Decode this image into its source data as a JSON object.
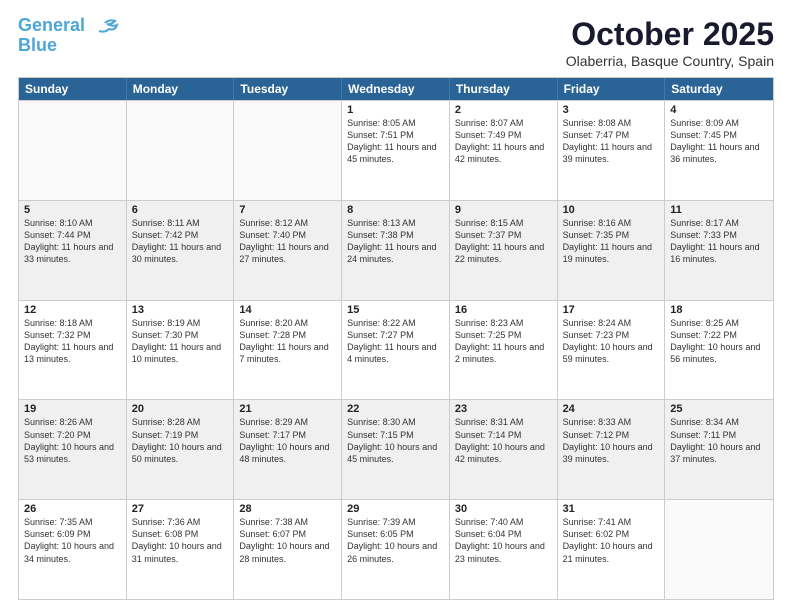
{
  "logo": {
    "line1": "General",
    "line2": "Blue"
  },
  "header": {
    "month": "October 2025",
    "location": "Olaberria, Basque Country, Spain"
  },
  "dayHeaders": [
    "Sunday",
    "Monday",
    "Tuesday",
    "Wednesday",
    "Thursday",
    "Friday",
    "Saturday"
  ],
  "weeks": [
    [
      {
        "num": "",
        "info": "",
        "empty": true
      },
      {
        "num": "",
        "info": "",
        "empty": true
      },
      {
        "num": "",
        "info": "",
        "empty": true
      },
      {
        "num": "1",
        "info": "Sunrise: 8:05 AM\nSunset: 7:51 PM\nDaylight: 11 hours\nand 45 minutes."
      },
      {
        "num": "2",
        "info": "Sunrise: 8:07 AM\nSunset: 7:49 PM\nDaylight: 11 hours\nand 42 minutes."
      },
      {
        "num": "3",
        "info": "Sunrise: 8:08 AM\nSunset: 7:47 PM\nDaylight: 11 hours\nand 39 minutes."
      },
      {
        "num": "4",
        "info": "Sunrise: 8:09 AM\nSunset: 7:45 PM\nDaylight: 11 hours\nand 36 minutes."
      }
    ],
    [
      {
        "num": "5",
        "info": "Sunrise: 8:10 AM\nSunset: 7:44 PM\nDaylight: 11 hours\nand 33 minutes."
      },
      {
        "num": "6",
        "info": "Sunrise: 8:11 AM\nSunset: 7:42 PM\nDaylight: 11 hours\nand 30 minutes."
      },
      {
        "num": "7",
        "info": "Sunrise: 8:12 AM\nSunset: 7:40 PM\nDaylight: 11 hours\nand 27 minutes."
      },
      {
        "num": "8",
        "info": "Sunrise: 8:13 AM\nSunset: 7:38 PM\nDaylight: 11 hours\nand 24 minutes."
      },
      {
        "num": "9",
        "info": "Sunrise: 8:15 AM\nSunset: 7:37 PM\nDaylight: 11 hours\nand 22 minutes."
      },
      {
        "num": "10",
        "info": "Sunrise: 8:16 AM\nSunset: 7:35 PM\nDaylight: 11 hours\nand 19 minutes."
      },
      {
        "num": "11",
        "info": "Sunrise: 8:17 AM\nSunset: 7:33 PM\nDaylight: 11 hours\nand 16 minutes."
      }
    ],
    [
      {
        "num": "12",
        "info": "Sunrise: 8:18 AM\nSunset: 7:32 PM\nDaylight: 11 hours\nand 13 minutes."
      },
      {
        "num": "13",
        "info": "Sunrise: 8:19 AM\nSunset: 7:30 PM\nDaylight: 11 hours\nand 10 minutes."
      },
      {
        "num": "14",
        "info": "Sunrise: 8:20 AM\nSunset: 7:28 PM\nDaylight: 11 hours\nand 7 minutes."
      },
      {
        "num": "15",
        "info": "Sunrise: 8:22 AM\nSunset: 7:27 PM\nDaylight: 11 hours\nand 4 minutes."
      },
      {
        "num": "16",
        "info": "Sunrise: 8:23 AM\nSunset: 7:25 PM\nDaylight: 11 hours\nand 2 minutes."
      },
      {
        "num": "17",
        "info": "Sunrise: 8:24 AM\nSunset: 7:23 PM\nDaylight: 10 hours\nand 59 minutes."
      },
      {
        "num": "18",
        "info": "Sunrise: 8:25 AM\nSunset: 7:22 PM\nDaylight: 10 hours\nand 56 minutes."
      }
    ],
    [
      {
        "num": "19",
        "info": "Sunrise: 8:26 AM\nSunset: 7:20 PM\nDaylight: 10 hours\nand 53 minutes."
      },
      {
        "num": "20",
        "info": "Sunrise: 8:28 AM\nSunset: 7:19 PM\nDaylight: 10 hours\nand 50 minutes."
      },
      {
        "num": "21",
        "info": "Sunrise: 8:29 AM\nSunset: 7:17 PM\nDaylight: 10 hours\nand 48 minutes."
      },
      {
        "num": "22",
        "info": "Sunrise: 8:30 AM\nSunset: 7:15 PM\nDaylight: 10 hours\nand 45 minutes."
      },
      {
        "num": "23",
        "info": "Sunrise: 8:31 AM\nSunset: 7:14 PM\nDaylight: 10 hours\nand 42 minutes."
      },
      {
        "num": "24",
        "info": "Sunrise: 8:33 AM\nSunset: 7:12 PM\nDaylight: 10 hours\nand 39 minutes."
      },
      {
        "num": "25",
        "info": "Sunrise: 8:34 AM\nSunset: 7:11 PM\nDaylight: 10 hours\nand 37 minutes."
      }
    ],
    [
      {
        "num": "26",
        "info": "Sunrise: 7:35 AM\nSunset: 6:09 PM\nDaylight: 10 hours\nand 34 minutes."
      },
      {
        "num": "27",
        "info": "Sunrise: 7:36 AM\nSunset: 6:08 PM\nDaylight: 10 hours\nand 31 minutes."
      },
      {
        "num": "28",
        "info": "Sunrise: 7:38 AM\nSunset: 6:07 PM\nDaylight: 10 hours\nand 28 minutes."
      },
      {
        "num": "29",
        "info": "Sunrise: 7:39 AM\nSunset: 6:05 PM\nDaylight: 10 hours\nand 26 minutes."
      },
      {
        "num": "30",
        "info": "Sunrise: 7:40 AM\nSunset: 6:04 PM\nDaylight: 10 hours\nand 23 minutes."
      },
      {
        "num": "31",
        "info": "Sunrise: 7:41 AM\nSunset: 6:02 PM\nDaylight: 10 hours\nand 21 minutes."
      },
      {
        "num": "",
        "info": "",
        "empty": true
      }
    ]
  ]
}
